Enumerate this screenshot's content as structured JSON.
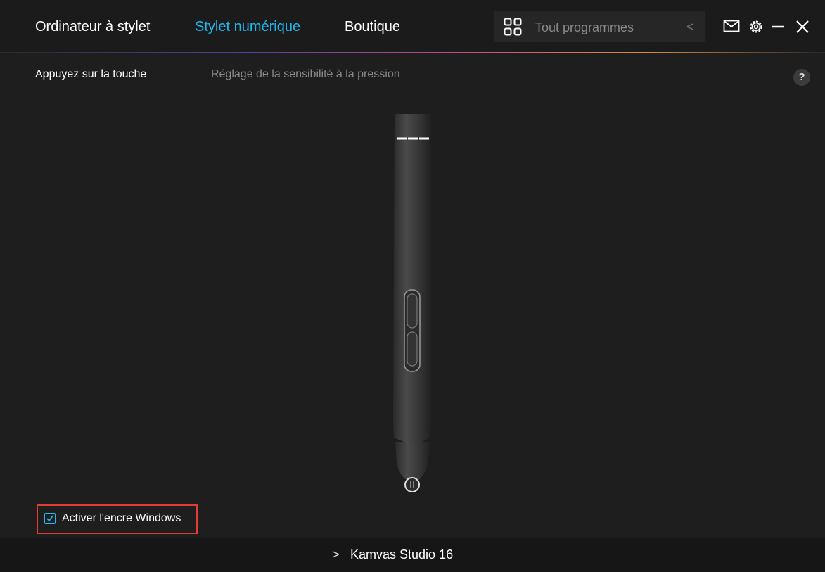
{
  "nav": {
    "tabs": [
      {
        "label": "Ordinateur à stylet"
      },
      {
        "label": "Stylet numérique"
      },
      {
        "label": "Boutique"
      }
    ],
    "active_tab": "Stylet numérique"
  },
  "program_selector": {
    "label": "Tout programmes",
    "icon": "grid-icon"
  },
  "window_controls": [
    "mail-icon",
    "gear-icon",
    "minimize-icon",
    "close-icon"
  ],
  "subtabs": [
    {
      "label": "Appuyez sur la touche"
    },
    {
      "label": "Réglage de la sensibilité à la pression"
    }
  ],
  "help": {
    "label": "?"
  },
  "windows_ink": {
    "label": "Activer l'encre Windows",
    "checked": true
  },
  "footer": {
    "device": "Kamvas Studio 16"
  },
  "colors": {
    "accent": "#1fb8ef",
    "highlight": "#e33c34",
    "background": "#1e1e1e"
  }
}
